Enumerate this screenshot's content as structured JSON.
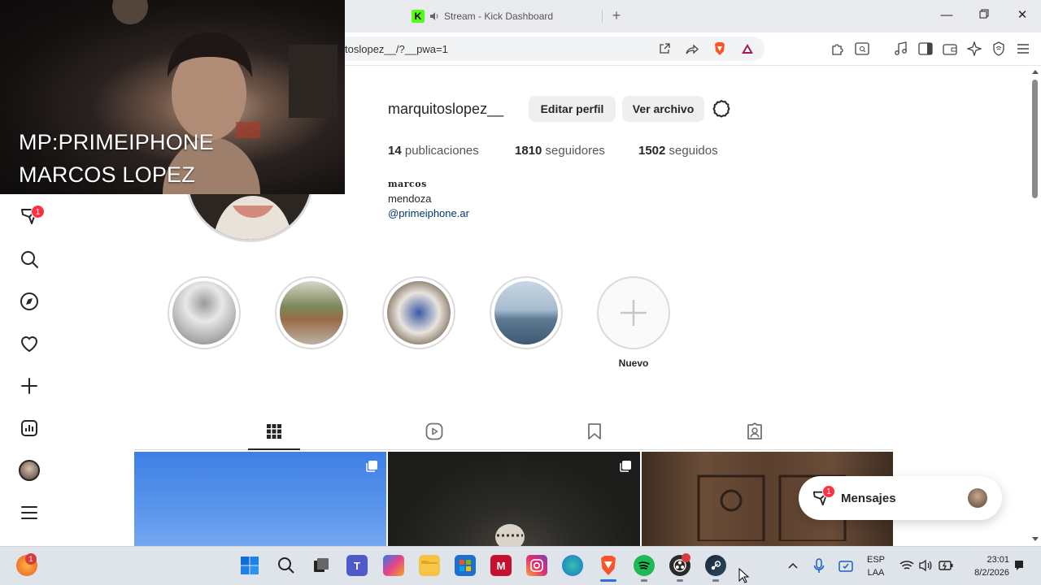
{
  "browser": {
    "tab_title": "Stream - Kick Dashboard",
    "tab_favicon_letter": "K",
    "url": "toslopez__/?__pwa=1"
  },
  "webcam": {
    "line1": "MP:PRIMEIPHONE",
    "line2": "MARCOS LOPEZ"
  },
  "nav": {
    "notification_badge": "1"
  },
  "profile": {
    "username": "marquitoslopez__",
    "edit_button": "Editar perfil",
    "archive_button": "Ver archivo",
    "stats": {
      "posts_count": "14",
      "posts_label": "publicaciones",
      "followers_count": "1810",
      "followers_label": "seguidores",
      "following_count": "1502",
      "following_label": "seguidos"
    },
    "bio_name": "𝐦𝐚𝐫𝐜𝐨𝐬",
    "bio_location": "mendoza",
    "bio_link": "@primeiphone.ar"
  },
  "highlights": {
    "new_label": "Nuevo"
  },
  "messages": {
    "label": "Mensajes",
    "badge": "1"
  },
  "taskbar": {
    "start_badge": "1",
    "lang_top": "ESP",
    "lang_bottom": "LAA",
    "time": "23:01",
    "date": "8/2/2026"
  },
  "colors": {
    "instagram_badge": "#ff3040",
    "link": "#00376b",
    "kick_green": "#53fc18"
  }
}
